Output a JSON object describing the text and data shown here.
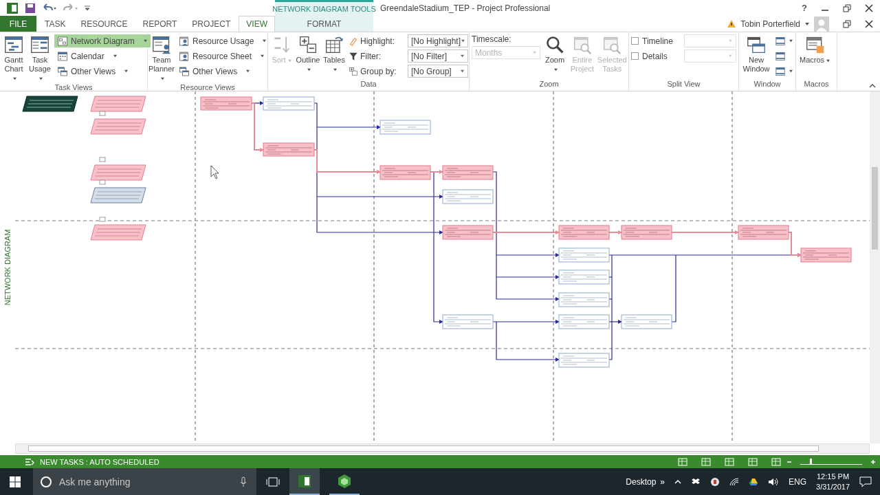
{
  "title_bar": {
    "context_label": "NETWORK DIAGRAM TOOLS",
    "title": "GreendaleStadium_TEP - Project Professional",
    "help": "?"
  },
  "tabs": [
    {
      "label": "FILE",
      "kind": "file",
      "selected": false
    },
    {
      "label": "TASK",
      "kind": "normal",
      "selected": false
    },
    {
      "label": "RESOURCE",
      "kind": "normal",
      "selected": false
    },
    {
      "label": "REPORT",
      "kind": "normal",
      "selected": false
    },
    {
      "label": "PROJECT",
      "kind": "normal",
      "selected": false
    },
    {
      "label": "VIEW",
      "kind": "normal",
      "selected": true
    },
    {
      "label": "FORMAT",
      "kind": "contextual",
      "selected": false
    }
  ],
  "account": {
    "name": "Tobin Porterfield"
  },
  "ribbon": [
    {
      "title": "Task Views",
      "items": [
        {
          "kind": "large",
          "label": "Gantt Chart",
          "dropdown": true,
          "disabled": false
        },
        {
          "kind": "large",
          "label": "Task Usage",
          "dropdown": true,
          "disabled": false
        },
        {
          "kind": "stack",
          "rows": [
            {
              "kind": "small",
              "label": "Network Diagram",
              "dropdown": true,
              "selected": true
            },
            {
              "kind": "small",
              "label": "Calendar",
              "dropdown": true,
              "selected": false
            },
            {
              "kind": "small",
              "label": "Other Views",
              "dropdown": true,
              "selected": false
            }
          ]
        }
      ]
    },
    {
      "title": "Resource Views",
      "items": [
        {
          "kind": "large",
          "label": "Team Planner",
          "dropdown": true,
          "disabled": false
        },
        {
          "kind": "stack",
          "rows": [
            {
              "kind": "small",
              "label": "Resource Usage",
              "dropdown": true,
              "selected": false
            },
            {
              "kind": "small",
              "label": "Resource Sheet",
              "dropdown": true,
              "selected": false
            },
            {
              "kind": "small",
              "label": "Other Views",
              "dropdown": true,
              "selected": false
            }
          ]
        }
      ]
    },
    {
      "title": "Data",
      "items": [
        {
          "kind": "large",
          "label": "Sort",
          "dropdown": true,
          "disabled": true
        },
        {
          "kind": "large",
          "label": "Outline",
          "dropdown": true,
          "disabled": false
        },
        {
          "kind": "large",
          "label": "Tables",
          "dropdown": true,
          "disabled": false
        },
        {
          "kind": "stack",
          "rows": [
            {
              "kind": "select",
              "label": "Highlight:",
              "value": "[No Highlight]",
              "disabled": false
            },
            {
              "kind": "select",
              "label": "Filter:",
              "value": "[No Filter]",
              "disabled": false
            },
            {
              "kind": "select",
              "label": "Group by:",
              "value": "[No Group]",
              "disabled": false
            }
          ]
        }
      ]
    },
    {
      "title": "Zoom",
      "items": [
        {
          "kind": "stack",
          "rows": [
            {
              "kind": "text",
              "label": "Timescale:"
            },
            {
              "kind": "select",
              "value": "Months",
              "disabled": true
            }
          ]
        },
        {
          "kind": "large",
          "label": "Zoom",
          "dropdown": true,
          "disabled": false
        },
        {
          "kind": "large",
          "label": "Entire Project",
          "dropdown": false,
          "disabled": true
        },
        {
          "kind": "large",
          "label": "Selected Tasks",
          "dropdown": false,
          "disabled": true
        }
      ]
    },
    {
      "title": "Split View",
      "items": [
        {
          "kind": "stack",
          "rows": [
            {
              "kind": "check",
              "label": "Timeline",
              "checked": false
            },
            {
              "kind": "check",
              "label": "Details",
              "checked": false
            }
          ]
        }
      ]
    },
    {
      "title": "Window",
      "items": [
        {
          "kind": "large",
          "label": "New Window",
          "dropdown": false,
          "disabled": false
        },
        {
          "kind": "stack",
          "rows": [
            {
              "kind": "icon",
              "dropdown": true
            },
            {
              "kind": "icon",
              "dropdown": false
            },
            {
              "kind": "icon",
              "dropdown": true
            }
          ]
        }
      ]
    },
    {
      "title": "Macros",
      "items": [
        {
          "kind": "large",
          "label": "Macros",
          "dropdown": true,
          "disabled": false
        }
      ]
    }
  ],
  "side_label": "NETWORK DIAGRAM",
  "status_bar": {
    "text": "NEW TASKS : AUTO SCHEDULED",
    "zoom_slider": {
      "level": 0.15
    }
  },
  "taskbar": {
    "search_placeholder": "Ask me anything",
    "desktop_label": "Desktop",
    "overflow": "»",
    "language": "ENG",
    "time": "12:15 PM",
    "date": "3/31/2017"
  }
}
